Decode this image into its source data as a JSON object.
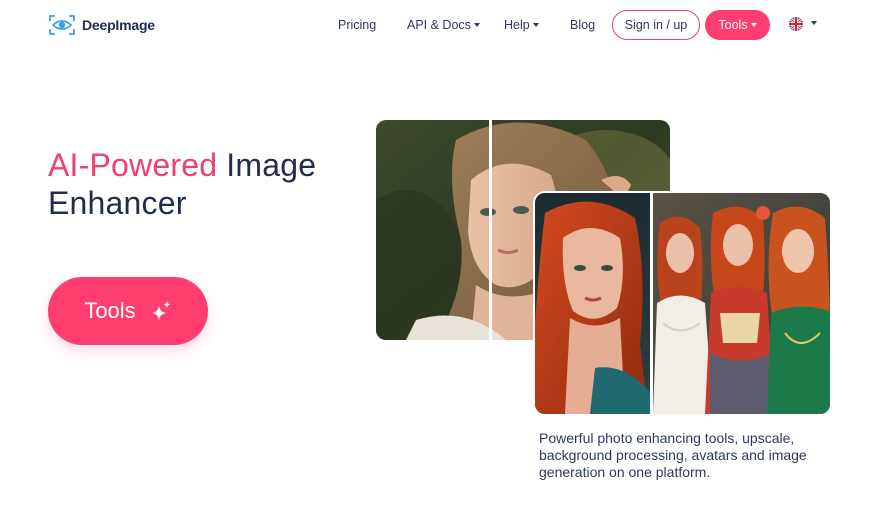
{
  "brand": {
    "name": "DeepImage"
  },
  "nav": {
    "pricing": "Pricing",
    "api_docs": "API & Docs",
    "help": "Help",
    "blog": "Blog",
    "signin": "Sign in / up",
    "tools": "Tools",
    "language_icon": "uk-flag-icon"
  },
  "hero": {
    "title_highlight": "AI-Powered",
    "title_rest_line1": " Image",
    "title_line2": "Enhancer",
    "cta_label": "Tools",
    "cta_icon": "sparkle-icon",
    "description": "Powerful photo enhancing tools, upscale, background processing, avatars and image generation on one platform."
  },
  "colors": {
    "accent": "#ff3d6e",
    "text_dark": "#1f2d4d",
    "logo_blue": "#3aa3e3"
  }
}
